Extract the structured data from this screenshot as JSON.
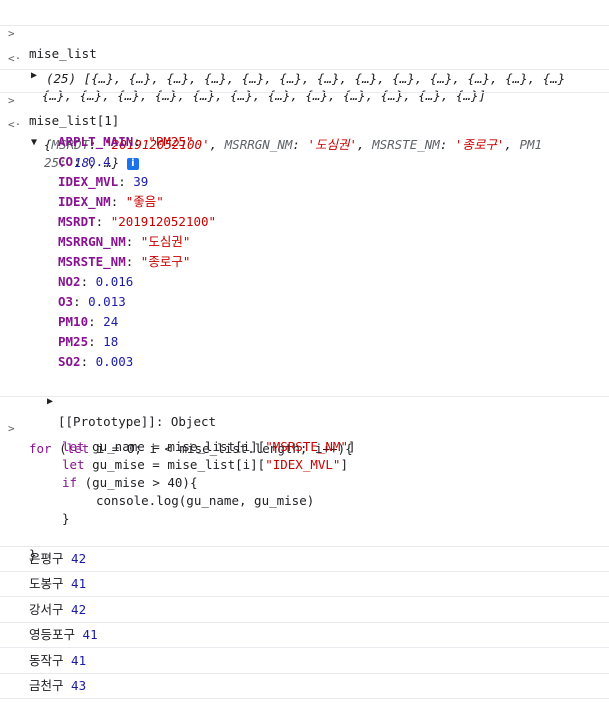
{
  "glyphs": {
    "prompt": ">",
    "result": "<·",
    "collapsed": "▶",
    "expanded": "▼",
    "info": "i"
  },
  "cmd1": "mise_list",
  "result1": {
    "line1": "(25) [{…}, {…}, {…}, {…}, {…}, {…}, {…}, {…}, {…}, {…}, {…}, {…}, {…}",
    "line2": "{…}, {…}, {…}, {…}, {…}, {…}, {…}, {…}, {…}, {…}, {…}, {…}]"
  },
  "cmd2": "mise_list[1]",
  "preview": {
    "open": "{",
    "k1": "MSRDT",
    "v1": "'201912052100'",
    "k2": "MSRRGN_NM",
    "v2": "'도심권'",
    "k3": "MSRSTE_NM",
    "v3": "'종로구'",
    "k4": "PM1",
    "line2a": "25: ",
    "line2b": "18",
    "line2c": ", …}"
  },
  "props": [
    {
      "key": "ARPLT_MAIN",
      "value": "\"PM25\"",
      "type": "str"
    },
    {
      "key": "CO",
      "value": "0.4",
      "type": "num"
    },
    {
      "key": "IDEX_MVL",
      "value": "39",
      "type": "num"
    },
    {
      "key": "IDEX_NM",
      "value": "\"좋음\"",
      "type": "str"
    },
    {
      "key": "MSRDT",
      "value": "\"201912052100\"",
      "type": "str"
    },
    {
      "key": "MSRRGN_NM",
      "value": "\"도심권\"",
      "type": "str"
    },
    {
      "key": "MSRSTE_NM",
      "value": "\"종로구\"",
      "type": "str"
    },
    {
      "key": "NO2",
      "value": "0.016",
      "type": "num"
    },
    {
      "key": "O3",
      "value": "0.013",
      "type": "num"
    },
    {
      "key": "PM10",
      "value": "24",
      "type": "num"
    },
    {
      "key": "PM25",
      "value": "18",
      "type": "num"
    },
    {
      "key": "SO2",
      "value": "0.003",
      "type": "num"
    }
  ],
  "prototype": "[[Prototype]]: Object",
  "code": {
    "l1a": "for",
    "l1b": " (",
    "l1c": "let",
    "l1d": " i = 0; i < mise_list.length; i++){",
    "l2a": "let",
    "l2b": " gu_name = mise_list[i][",
    "l2c": "\"MSRSTE_NM\"",
    "l2d": "]",
    "l3a": "let",
    "l3b": " gu_mise = mise_list[i][",
    "l3c": "\"IDEX_MVL\"",
    "l3d": "]",
    "l4a": "if",
    "l4b": " (gu_mise > 40){",
    "l5": "console.log(gu_name, gu_mise)",
    "l6": "}",
    "l7": "}"
  },
  "outputs": [
    {
      "name": "은평구",
      "value": "42"
    },
    {
      "name": "도봉구",
      "value": "41"
    },
    {
      "name": "강서구",
      "value": "42"
    },
    {
      "name": "영등포구",
      "value": "41"
    },
    {
      "name": "동작구",
      "value": "41"
    },
    {
      "name": "금천구",
      "value": "43"
    }
  ]
}
